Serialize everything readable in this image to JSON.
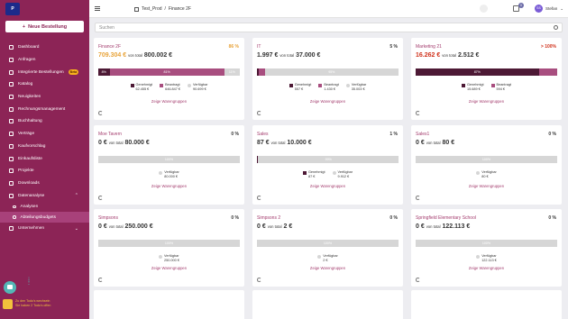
{
  "sidebar": {
    "logo_text": "P",
    "new_order_label": "Neue Bestellung",
    "items": [
      {
        "label": "Dashboard"
      },
      {
        "label": "Anfragen"
      },
      {
        "label": "Integrierte Bestellungen",
        "badge": "Beta"
      },
      {
        "label": "Katalog"
      },
      {
        "label": "Neuigkeiten"
      },
      {
        "label": "Rechnungsmanagement"
      },
      {
        "label": "Buchhaltung"
      },
      {
        "label": "Verträge"
      },
      {
        "label": "Kaufvorschlag"
      },
      {
        "label": "Einkaufsliste"
      },
      {
        "label": "Projekte"
      },
      {
        "label": "Downloads"
      },
      {
        "label": "Datenanalyse"
      },
      {
        "label": "Analysen"
      },
      {
        "label": "Abteilungsbudgets"
      },
      {
        "label": "Unternehmen"
      }
    ],
    "todo": {
      "line1": "Zu den Todo's wechseln",
      "line2": "Sie haben 2 Todo's offen"
    }
  },
  "topbar": {
    "breadcrumb_root": "Test_Prod",
    "breadcrumb_sep": "/",
    "breadcrumb_current": "Finance 2F",
    "cart_count": "0",
    "user_initials": "SS",
    "user_name": "Stefan"
  },
  "search": {
    "placeholder": "Suchen"
  },
  "labels": {
    "of_total": "von total",
    "approved": "Genehmigt",
    "requested": "Beantragt",
    "available": "Verfügbar",
    "show_groups": "Zeige Warengruppen"
  },
  "colors": {
    "approved": "#4d1935",
    "requested": "#a84e7f",
    "available": "#d6d6d6",
    "brand": "#8c2456"
  },
  "cards": [
    {
      "title": "Finance 2F",
      "pct": "86 %",
      "status": "warn",
      "used": "709.304 €",
      "total": "800.002 €",
      "segments": [
        {
          "type": "app",
          "value": 0.08,
          "label": "8%"
        },
        {
          "type": "req",
          "value": 0.81,
          "label": "81%"
        },
        {
          "type": "av",
          "value": 0.11,
          "label": "11%"
        }
      ],
      "approved": "62.455 €",
      "requested": "646.847 €",
      "available": "90.699 €"
    },
    {
      "title": "IT",
      "pct": "5 %",
      "status": "normal",
      "used": "1.997 €",
      "total": "37.000 €",
      "segments": [
        {
          "type": "app",
          "value": 0.015,
          "label": ""
        },
        {
          "type": "req",
          "value": 0.04,
          "label": ""
        },
        {
          "type": "av",
          "value": 0.945,
          "label": "95%"
        }
      ],
      "approved": "557 €",
      "requested": "1.430 €",
      "available": "35.003 €"
    },
    {
      "title": "Marketing 21",
      "pct": "> 100%",
      "status": "over",
      "used": "16.262 €",
      "total": "2.512 €",
      "segments": [
        {
          "type": "app",
          "value": 0.87,
          "label": "87%"
        },
        {
          "type": "req",
          "value": 0.13,
          "label": ""
        }
      ],
      "approved": "15.689 €",
      "requested": "594 €",
      "available": null
    },
    {
      "title": "Moe Tavern",
      "pct": "0 %",
      "status": "normal",
      "used": "0 €",
      "total": "80.000 €",
      "segments": [
        {
          "type": "av",
          "value": 1,
          "label": "100%"
        }
      ],
      "approved": null,
      "requested": null,
      "available": "80.000 €"
    },
    {
      "title": "Sales",
      "pct": "1 %",
      "status": "normal",
      "used": "87 €",
      "total": "10.000 €",
      "segments": [
        {
          "type": "app",
          "value": 0.009,
          "label": ""
        },
        {
          "type": "av",
          "value": 0.991,
          "label": "99%"
        }
      ],
      "approved": "87 €",
      "requested": null,
      "available": "9.912 €"
    },
    {
      "title": "Sales1",
      "pct": "0 %",
      "status": "normal",
      "used": "0 €",
      "total": "80 €",
      "segments": [
        {
          "type": "av",
          "value": 1,
          "label": "100%"
        }
      ],
      "approved": null,
      "requested": null,
      "available": "80 €"
    },
    {
      "title": "Simpsons",
      "pct": "0 %",
      "status": "normal",
      "used": "0 €",
      "total": "250.000 €",
      "segments": [
        {
          "type": "av",
          "value": 1,
          "label": "100%"
        }
      ],
      "approved": null,
      "requested": null,
      "available": "250.000 €"
    },
    {
      "title": "Simpsons 2",
      "pct": "0 %",
      "status": "normal",
      "used": "0 €",
      "total": "2 €",
      "segments": [
        {
          "type": "av",
          "value": 1,
          "label": "100%"
        }
      ],
      "approved": null,
      "requested": null,
      "available": "2 €"
    },
    {
      "title": "Springfield Elementary School",
      "pct": "0 %",
      "status": "normal",
      "used": "0 €",
      "total": "122.113 €",
      "segments": [
        {
          "type": "av",
          "value": 1,
          "label": "100%"
        }
      ],
      "approved": null,
      "requested": null,
      "available": "122.113 €"
    }
  ]
}
